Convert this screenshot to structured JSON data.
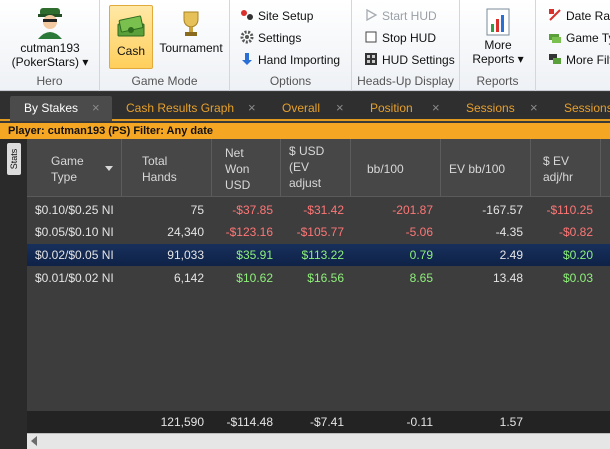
{
  "ribbon": {
    "hero": {
      "name_line1": "cutman193",
      "name_line2": "(PokerStars) ▾",
      "group_label": "Hero"
    },
    "game_mode": {
      "cash_label": "Cash",
      "tournament_label": "Tournament",
      "group_label": "Game Mode"
    },
    "options": {
      "site_setup": "Site Setup",
      "settings": "Settings",
      "hand_importing": "Hand Importing",
      "group_label": "Options"
    },
    "hud": {
      "start_hud": "Start HUD",
      "stop_hud": "Stop HUD",
      "hud_settings": "HUD Settings",
      "group_label": "Heads-Up Display"
    },
    "reports": {
      "more_reports_line1": "More",
      "more_reports_line2": "Reports ▾",
      "group_label": "Reports"
    },
    "extra": {
      "date_range": "Date Rar",
      "game_type": "Game Ty",
      "more_filters": "More Filt"
    }
  },
  "tabs": [
    {
      "label": "By Stakes"
    },
    {
      "label": "Cash Results Graph"
    },
    {
      "label": "Overall"
    },
    {
      "label": "Position"
    },
    {
      "label": "Sessions"
    },
    {
      "label": "Sessions"
    }
  ],
  "tab_close": "×",
  "filter_bar": "Player: cutman193 (PS)   Filter: Any date",
  "side_tab": "Stats",
  "grid": {
    "columns": [
      {
        "label": "Game\nType"
      },
      {
        "label": "Total\nHands"
      },
      {
        "label": "Net\nWon\nUSD"
      },
      {
        "label": "$ USD\n(EV\nadjust"
      },
      {
        "label": "bb/100"
      },
      {
        "label": "EV bb/100"
      },
      {
        "label": "$ EV\nadj/hr"
      }
    ],
    "rows": [
      {
        "game_type": "$0.10/$0.25 NI",
        "hands": "75",
        "net_won": "-$37.85",
        "ev_adjusted": "-$31.42",
        "bb100": "-201.87",
        "ev_bb100": "-167.57",
        "ev_adj_hr": "-$110.25"
      },
      {
        "game_type": "$0.05/$0.10 NI",
        "hands": "24,340",
        "net_won": "-$123.16",
        "ev_adjusted": "-$105.77",
        "bb100": "-5.06",
        "ev_bb100": "-4.35",
        "ev_adj_hr": "-$0.82"
      },
      {
        "game_type": "$0.02/$0.05 NI",
        "hands": "91,033",
        "net_won": "$35.91",
        "ev_adjusted": "$113.22",
        "bb100": "0.79",
        "ev_bb100": "2.49",
        "ev_adj_hr": "$0.20"
      },
      {
        "game_type": "$0.01/$0.02 NI",
        "hands": "6,142",
        "net_won": "$10.62",
        "ev_adjusted": "$16.56",
        "bb100": "8.65",
        "ev_bb100": "13.48",
        "ev_adj_hr": "$0.03"
      }
    ],
    "totals": {
      "hands": "121,590",
      "net_won": "-$114.48",
      "ev_adjusted": "-$7.41",
      "bb100": "-0.11",
      "ev_bb100": "1.57"
    }
  },
  "colors": {
    "accent_orange": "#e7a02c",
    "negative": "#ff7676",
    "positive": "#8ef07a",
    "selected_row": "#17305c"
  }
}
